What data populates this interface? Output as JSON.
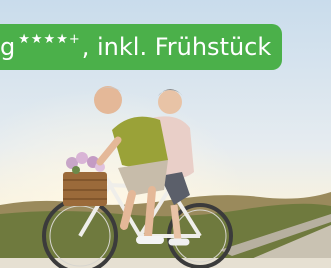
{
  "banner": {
    "lead": "g",
    "stars": "★★★★+",
    "text": ", inkl. Frühstück"
  },
  "photo": {
    "subject": "bicycle-couple-photo"
  },
  "colors": {
    "banner_green": "#4bb04a",
    "banner_text": "#ffffff",
    "sky_top": "#c9dcec",
    "sky_horizon": "#fbf3dc"
  }
}
